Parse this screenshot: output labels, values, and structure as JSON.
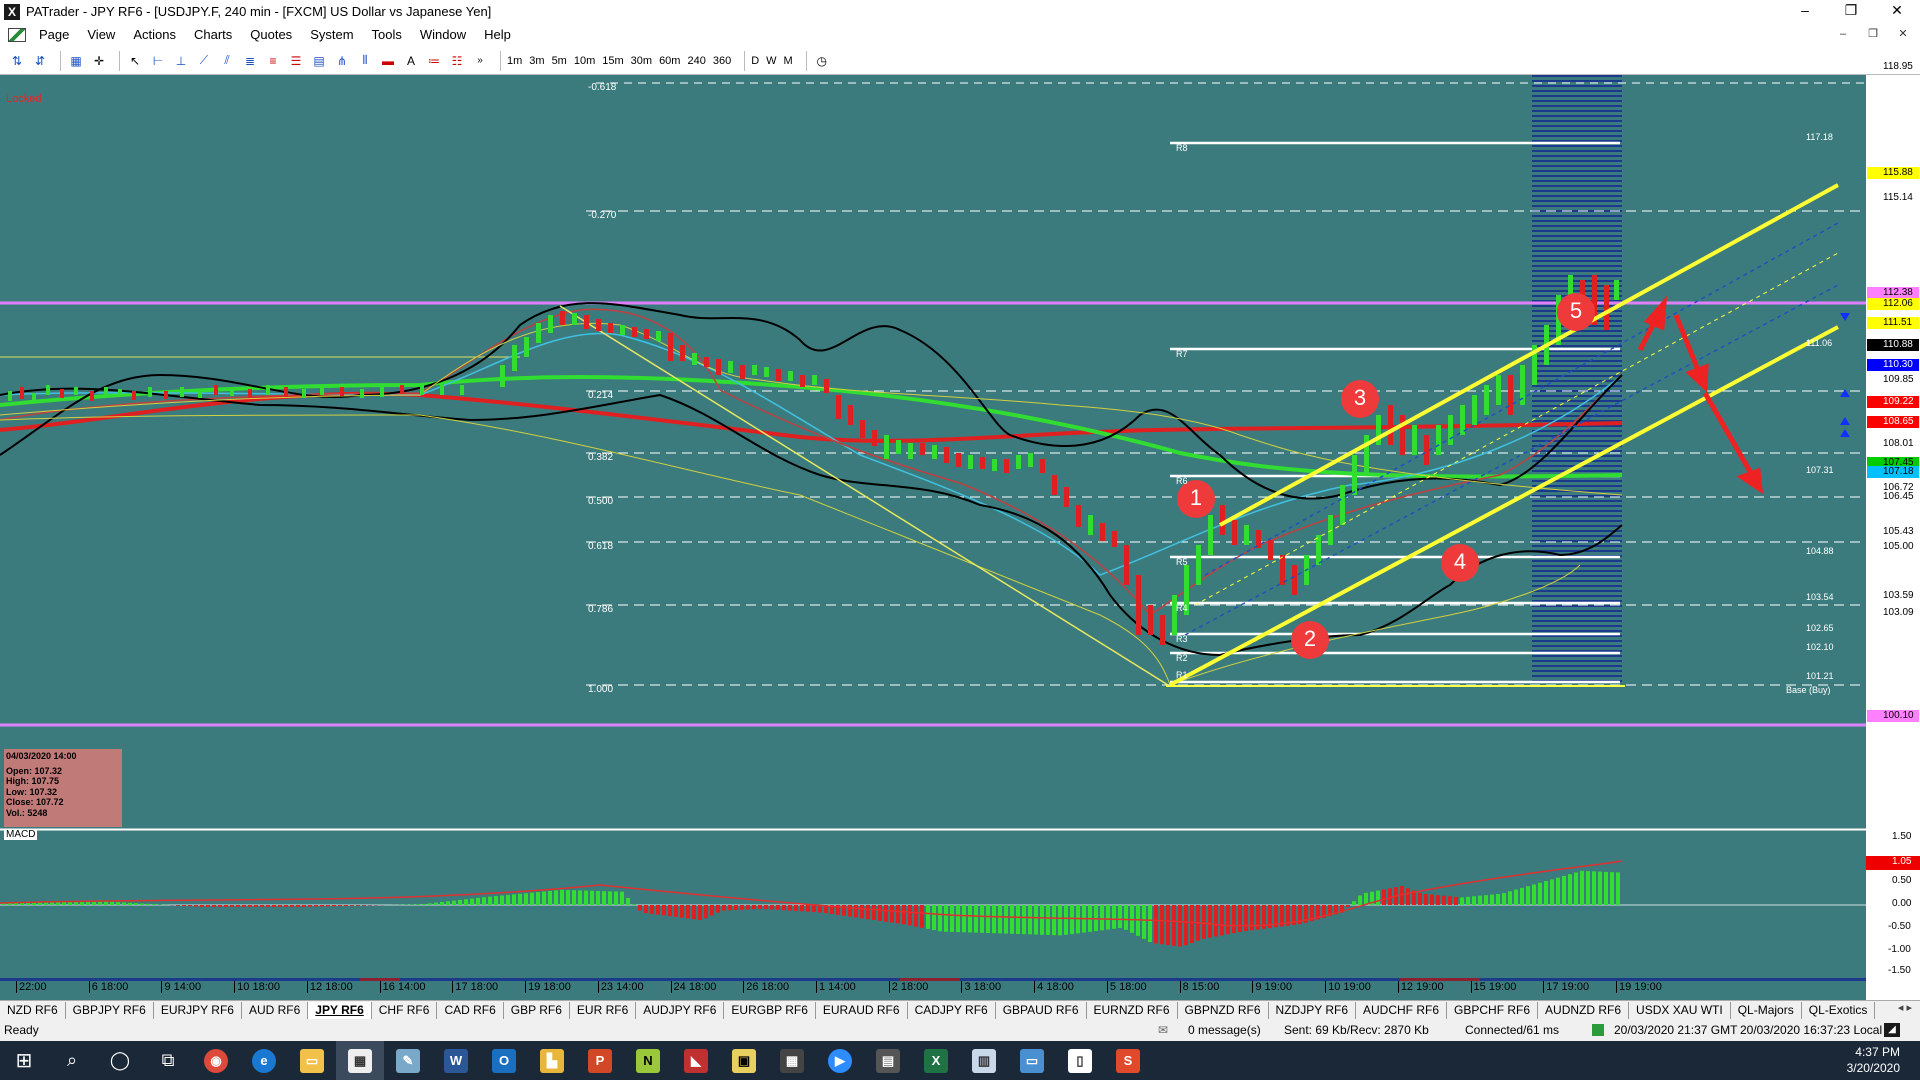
{
  "window": {
    "title": "PATrader - JPY RF6 - [USDJPY.F, 240 min - [FXCM] US Dollar vs Japanese Yen]",
    "minimize": "–",
    "maximize": "❐",
    "close": "✕"
  },
  "menu": {
    "items": [
      "Page",
      "View",
      "Actions",
      "Charts",
      "Quotes",
      "System",
      "Tools",
      "Window",
      "Help"
    ],
    "mdi": [
      "–",
      "❐",
      "✕"
    ]
  },
  "toolbar": {
    "timeframes": [
      "1m",
      "3m",
      "5m",
      "10m",
      "15m",
      "30m",
      "60m",
      "240",
      "360"
    ],
    "periods": [
      "D",
      "W",
      "M"
    ]
  },
  "chart": {
    "locked_label": "Locked",
    "fib_labels": [
      "-0.618",
      "-0.270",
      "0.214",
      "0.382",
      "0.500",
      "0.618",
      "0.786",
      "1.000"
    ],
    "pivot_labels": [
      {
        "name": "R8",
        "value": "117.18"
      },
      {
        "name": "R7",
        "value": "111.06"
      },
      {
        "name": "R6",
        "value": "107.31"
      },
      {
        "name": "R5",
        "value": "104.88"
      },
      {
        "name": "R4",
        "value": "103.54"
      },
      {
        "name": "R3",
        "value": "102.65"
      },
      {
        "name": "R2",
        "value": "102.10"
      },
      {
        "name": "R1",
        "value": "101.21"
      }
    ],
    "base_label": "Base (Buy)",
    "price_axis": [
      "118.95",
      "115.88",
      "115.14",
      "112.38",
      "112.06",
      "111.51",
      "110.88",
      "110.30",
      "109.85",
      "109.22",
      "108.65",
      "108.01",
      "107.45",
      "107.18",
      "106.72",
      "106.45",
      "105.43",
      "105.00",
      "103.59",
      "103.09",
      "100.10"
    ],
    "price_colors": {
      "115.88": "#ffff00",
      "112.38": "#ff80ff",
      "112.06": "#ffff00",
      "111.51": "#ffff00",
      "110.88": "#000000",
      "110.30": "#0000ff",
      "109.22": "#ff0000",
      "108.65": "#ff0000",
      "107.45": "#00cc00",
      "107.18": "#00c0ff",
      "100.10": "#ff80ff"
    },
    "wave_numbers": [
      "1",
      "2",
      "3",
      "4",
      "5"
    ],
    "time_axis": [
      "22:00",
      "6 18:00",
      "9 14:00",
      "10 18:00",
      "12 18:00",
      "16 14:00",
      "17 18:00",
      "19 18:00",
      "23 14:00",
      "24 18:00",
      "26 18:00",
      "1 14:00",
      "2 18:00",
      "3 18:00",
      "4 18:00",
      "5 18:00",
      "8 15:00",
      "9 19:00",
      "10 19:00",
      "12 19:00",
      "15 19:00",
      "17 19:00",
      "19 19:00"
    ],
    "ohlc": {
      "date": "04/03/2020 14:00",
      "open": "Open: 107.32",
      "high": "High: 107.75",
      "low": "Low: 107.32",
      "close": "Close: 107.72",
      "vol": "Vol.: 5248"
    },
    "macd_label": "MACD",
    "macd_axis": [
      "1.50",
      "1.05",
      "0.50",
      "0.00",
      "-0.50",
      "-1.00",
      "-1.50"
    ]
  },
  "tabs": {
    "items": [
      "NZD RF6",
      "GBPJPY RF6",
      "EURJPY RF6",
      "AUD RF6",
      "JPY RF6",
      "CHF RF6",
      "CAD RF6",
      "GBP RF6",
      "EUR RF6",
      "AUDJPY RF6",
      "EURGBP RF6",
      "EURAUD RF6",
      "CADJPY RF6",
      "GBPAUD RF6",
      "EURNZD RF6",
      "GBPNZD RF6",
      "NZDJPY RF6",
      "AUDCHF RF6",
      "GBPCHF RF6",
      "AUDNZD RF6",
      "USDX XAU WTI",
      "QL-Majors",
      "QL-Exotics"
    ],
    "active": "JPY RF6",
    "arrows": "◂ ▸"
  },
  "status": {
    "ready": "Ready",
    "messages": "0 message(s)",
    "traffic": "Sent: 69 Kb/Recv: 2870 Kb",
    "connection": "Connected/61 ms",
    "gmt_time": "20/03/2020 21:37 GMT",
    "local_time": "20/03/2020 16:37:23 Local"
  },
  "taskbar": {
    "time": "4:37 PM",
    "date": "3/20/2020"
  }
}
